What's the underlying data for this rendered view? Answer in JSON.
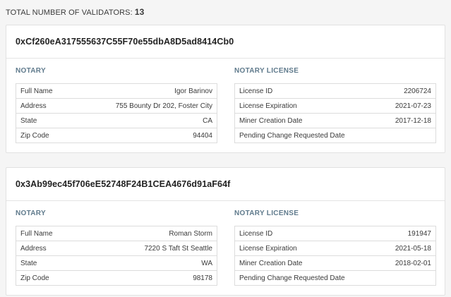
{
  "summary": {
    "label": "TOTAL NUMBER OF VALIDATORS:",
    "count": "13"
  },
  "validators": [
    {
      "address": "0xCf260eA317555637C55F70e55dbA8D5ad8414Cb0",
      "notary_title": "NOTARY",
      "license_title": "NOTARY LICENSE",
      "notary": [
        {
          "label": "Full Name",
          "value": "Igor Barinov"
        },
        {
          "label": "Address",
          "value": "755 Bounty Dr 202, Foster City"
        },
        {
          "label": "State",
          "value": "CA"
        },
        {
          "label": "Zip Code",
          "value": "94404"
        }
      ],
      "license": [
        {
          "label": "License ID",
          "value": "2206724"
        },
        {
          "label": "License Expiration",
          "value": "2021-07-23"
        },
        {
          "label": "Miner Creation Date",
          "value": "2017-12-18"
        },
        {
          "label": "Pending Change Requested Date",
          "value": ""
        }
      ]
    },
    {
      "address": "0x3Ab99ec45f706eE52748F24B1CEA4676d91aF64f",
      "notary_title": "NOTARY",
      "license_title": "NOTARY LICENSE",
      "notary": [
        {
          "label": "Full Name",
          "value": "Roman Storm"
        },
        {
          "label": "Address",
          "value": "7220 S Taft St Seattle"
        },
        {
          "label": "State",
          "value": "WA"
        },
        {
          "label": "Zip Code",
          "value": "98178"
        }
      ],
      "license": [
        {
          "label": "License ID",
          "value": "191947"
        },
        {
          "label": "License Expiration",
          "value": "2021-05-18"
        },
        {
          "label": "Miner Creation Date",
          "value": "2018-02-01"
        },
        {
          "label": "Pending Change Requested Date",
          "value": ""
        }
      ]
    }
  ]
}
